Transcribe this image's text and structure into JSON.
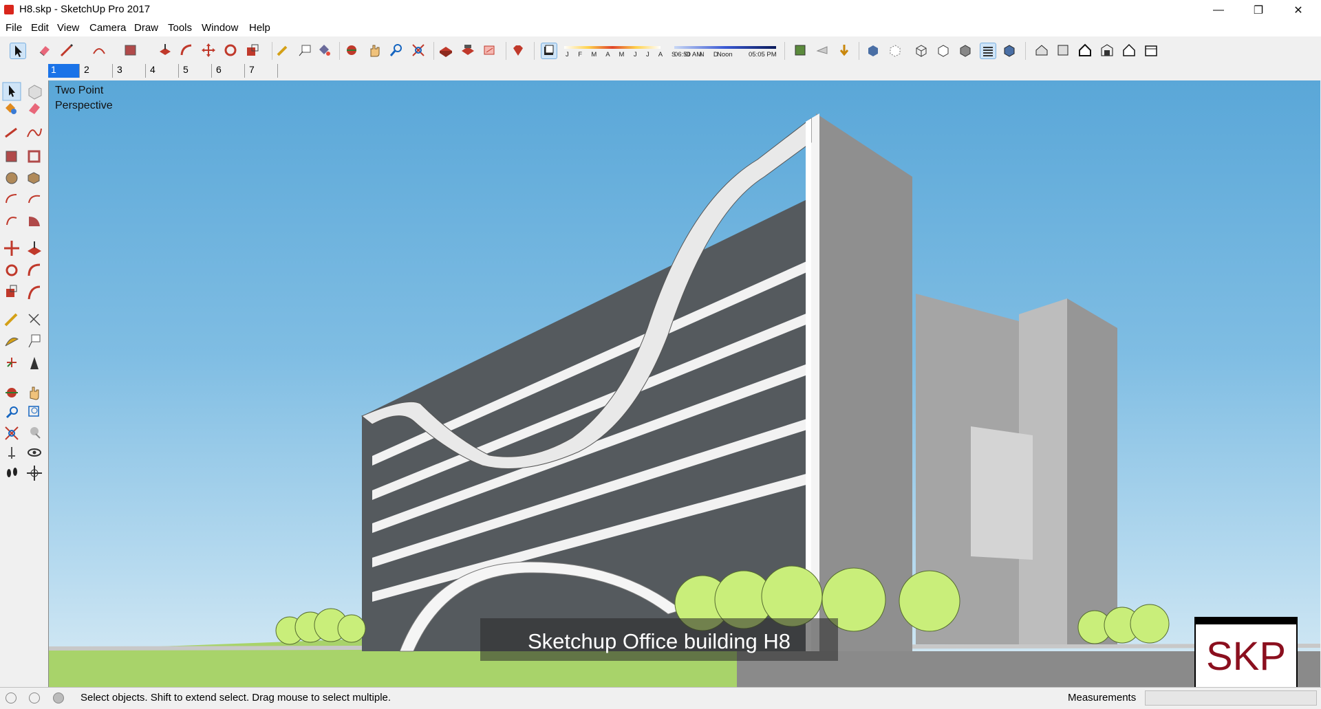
{
  "window": {
    "title": "H8.skp - SketchUp Pro 2017",
    "minimize_glyph": "—",
    "restore_glyph": "❐",
    "close_glyph": "✕"
  },
  "menu": {
    "items": [
      {
        "label": "File"
      },
      {
        "label": "Edit"
      },
      {
        "label": "View"
      },
      {
        "label": "Camera"
      },
      {
        "label": "Draw"
      },
      {
        "label": "Tools"
      },
      {
        "label": "Window"
      },
      {
        "label": "Help"
      }
    ]
  },
  "toolbar": {
    "icons": [
      "select-icon",
      "eraser-icon",
      "pencil-line-icon",
      "arc-icon",
      "rectangle-icon",
      "push-pull-icon",
      "follow-me-icon",
      "move-icon",
      "rotate-icon",
      "scale-icon",
      "tape-measure-icon",
      "text-icon",
      "paint-bucket-icon",
      "orbit-icon",
      "pan-icon",
      "zoom-icon",
      "zoom-extents-icon",
      "warehouse-icon",
      "extension-warehouse-icon",
      "layout-icon",
      "ruby-icon"
    ],
    "shadow": {
      "months": "J F M A M J J A S O N D",
      "time_start": "06:50 AM",
      "time_mid": "Noon",
      "time_end": "05:05 PM",
      "toggle_icon": "shadow-toggle-icon"
    },
    "styles_icons": [
      "xray-icon",
      "back-edges-icon",
      "wireframe-icon",
      "hidden-line-icon",
      "shaded-icon",
      "shaded-textures-icon",
      "monochrome-icon"
    ],
    "view_icons": [
      "iso-view-icon",
      "top-view-icon",
      "front-view-icon",
      "right-view-icon",
      "back-view-icon",
      "left-view-icon"
    ]
  },
  "scenes": {
    "tabs": [
      "1",
      "2",
      "3",
      "4",
      "5",
      "6",
      "7"
    ],
    "active": "1"
  },
  "viewport": {
    "camera_label_line1": "Two Point",
    "camera_label_line2": "Perspective",
    "caption": "Sketchup Office building H8",
    "logo_text": "SKP"
  },
  "status": {
    "message": "Select objects. Shift to extend select. Drag mouse to select multiple.",
    "measurements_label": "Measurements",
    "measurements_value": ""
  },
  "colors": {
    "sky_top": "#5aa7d8",
    "grass": "#a8d36a",
    "building_grey": "#9a9a9a",
    "tree_green": "#c9ee7a",
    "logo_red": "#8b0f1e",
    "active_scene": "#1a73e8"
  }
}
